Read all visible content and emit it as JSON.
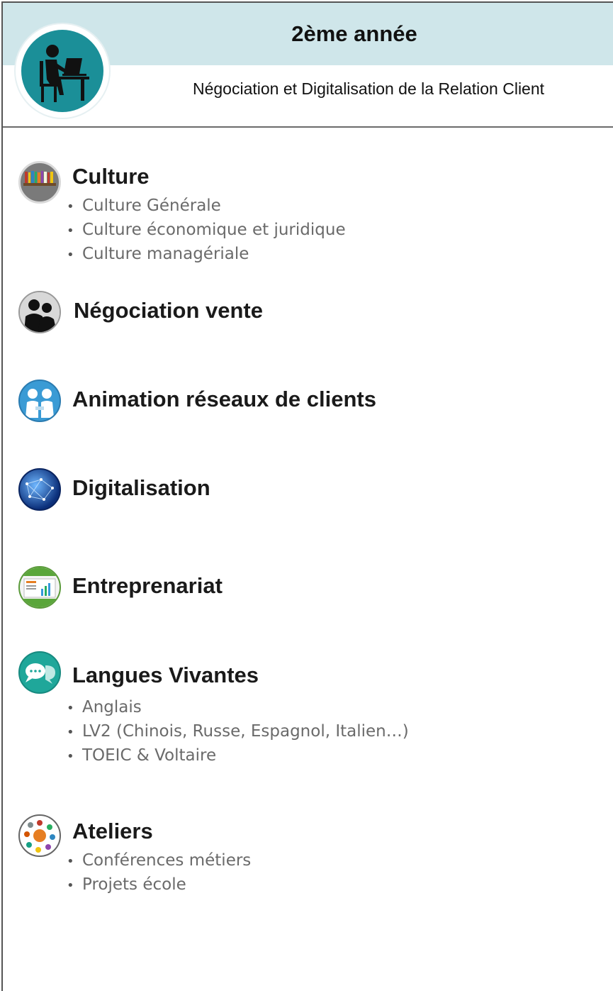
{
  "header": {
    "year": "2ème année",
    "program": "Négociation et Digitalisation de la Relation Client"
  },
  "sections": [
    {
      "title": "Culture",
      "icon": "bookshelf-icon",
      "items": [
        "Culture Générale",
        "Culture économique et juridique",
        "Culture managériale"
      ]
    },
    {
      "title": "Négociation vente",
      "icon": "business-people-icon",
      "items": []
    },
    {
      "title": "Animation réseaux de clients",
      "icon": "handshake-icon",
      "items": []
    },
    {
      "title": "Digitalisation",
      "icon": "network-globe-icon",
      "items": []
    },
    {
      "title": "Entreprenariat",
      "icon": "dashboard-monitor-icon",
      "items": []
    },
    {
      "title": "Langues Vivantes",
      "icon": "chat-bubbles-icon",
      "items": [
        "Anglais",
        "LV2 (Chinois, Russe, Espagnol, Italien…)",
        "TOEIC & Voltaire"
      ]
    },
    {
      "title": "Ateliers",
      "icon": "team-circle-icon",
      "items": [
        "Conférences métiers",
        "Projets école"
      ]
    }
  ],
  "colors": {
    "header_band": "#cfe6ea",
    "logo_teal": "#1b8f98",
    "item_text": "#6a6a6a"
  }
}
